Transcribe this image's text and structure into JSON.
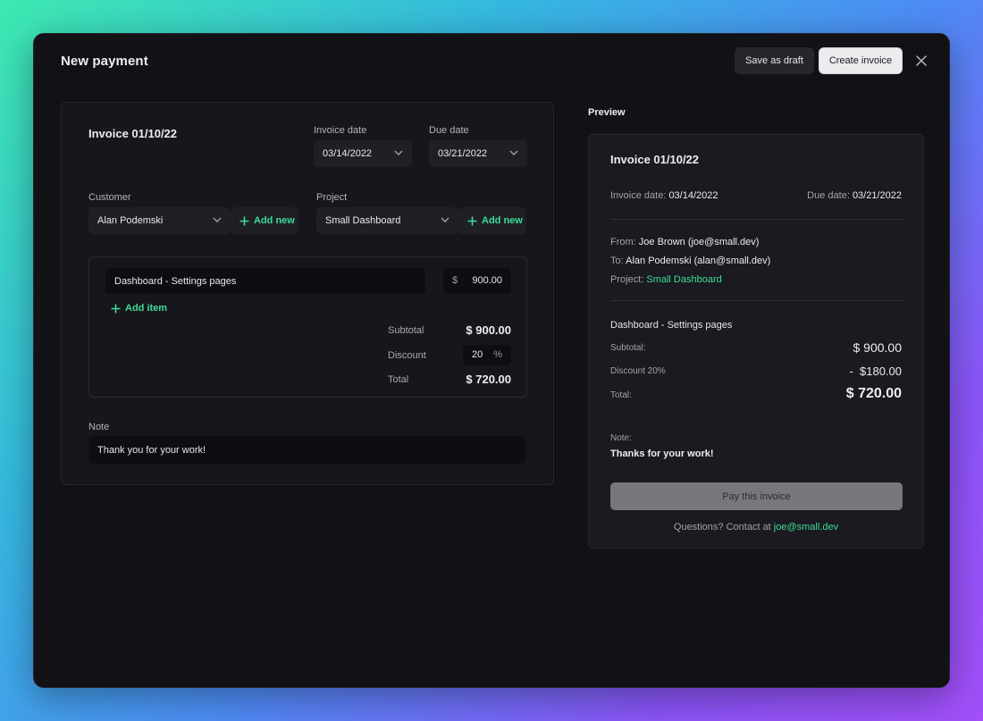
{
  "modal": {
    "title": "New payment",
    "save_draft_label": "Save as draft",
    "create_invoice_label": "Create invoice"
  },
  "form": {
    "invoice_title": "Invoice 01/10/22",
    "invoice_date_label": "Invoice date",
    "invoice_date_value": "03/14/2022",
    "due_date_label": "Due date",
    "due_date_value": "03/21/2022",
    "customer_label": "Customer",
    "customer_value": "Alan Podemski",
    "project_label": "Project",
    "project_value": "Small Dashboard",
    "add_new_label": "Add new",
    "items": [
      {
        "description": "Dashboard - Settings pages",
        "currency": "$",
        "amount": "900.00"
      }
    ],
    "add_item_label": "Add item",
    "subtotal_label": "Subtotal",
    "subtotal_value": "$ 900.00",
    "discount_label": "Discount",
    "discount_value": "20",
    "discount_unit": "%",
    "total_label": "Total",
    "total_value": "$ 720.00",
    "note_label": "Note",
    "note_value": "Thank you for your work!"
  },
  "preview": {
    "label": "Preview",
    "title": "Invoice 01/10/22",
    "invoice_date_label": "Invoice date:",
    "invoice_date_value": "03/14/2022",
    "due_date_label": "Due date:",
    "due_date_value": "03/21/2022",
    "from_label": "From:",
    "from_value": "Joe Brown (joe@small.dev)",
    "to_label": "To:",
    "to_value": "Alan Podemski (alan@small.dev)",
    "project_label": "Project:",
    "project_value": "Small Dashboard",
    "item_title": "Dashboard - Settings pages",
    "subtotal_label": "Subtotal:",
    "subtotal_value": "$ 900.00",
    "discount_label": "Discount 20%",
    "discount_value": "-  $180.00",
    "total_label": "Total:",
    "total_value": "$ 720.00",
    "note_label": "Note:",
    "note_value": "Thanks for your work!",
    "pay_button_label": "Pay this invoice",
    "questions_text": "Questions? Contact at",
    "contact_email": "joe@small.dev"
  },
  "colors": {
    "accent": "#3ddc97",
    "modal_bg": "#111116",
    "panel_bg": "#16161c"
  },
  "icons": [
    "close-icon",
    "chevron-down-icon",
    "plus-icon"
  ]
}
